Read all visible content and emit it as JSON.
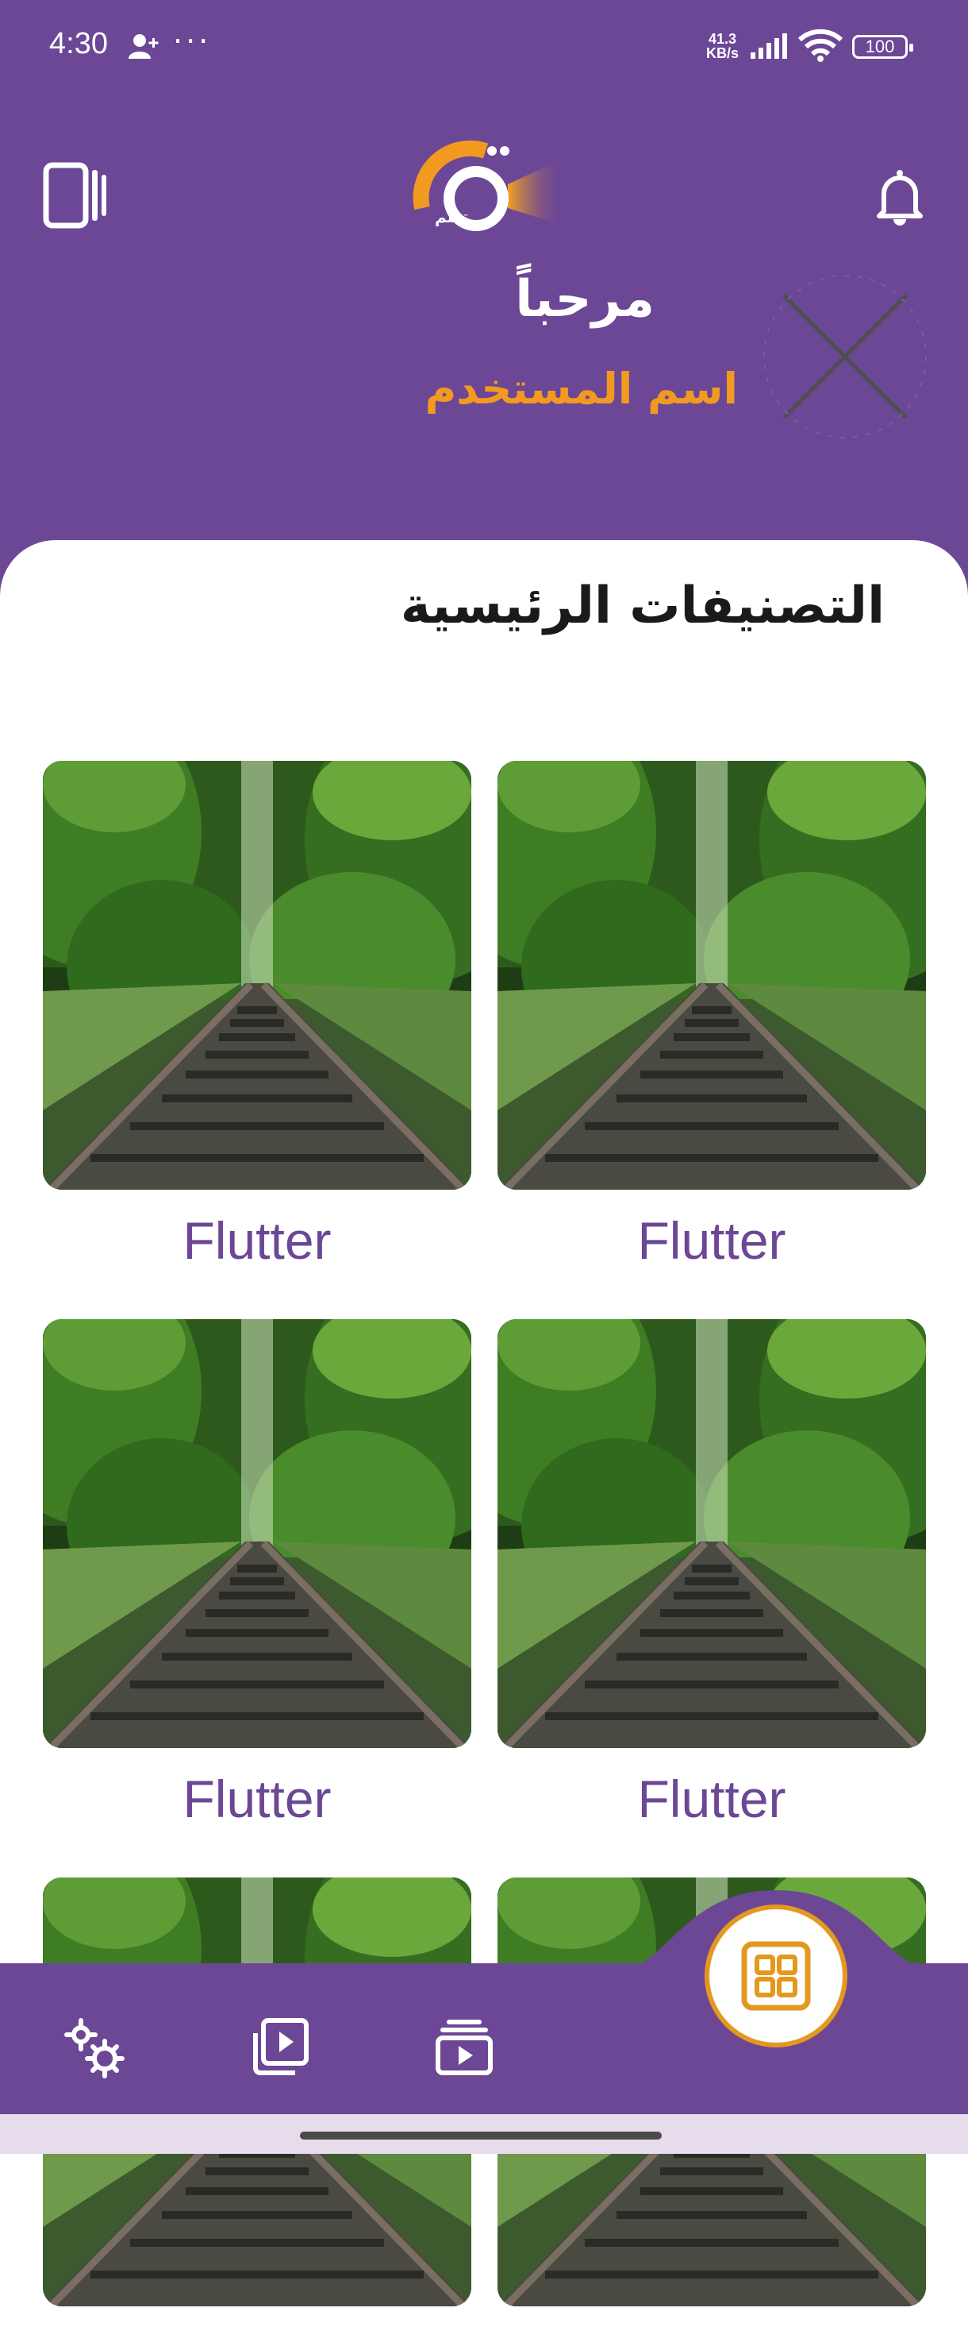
{
  "status_bar": {
    "time": "4:30",
    "dots": "···",
    "net_speed_value": "41.3",
    "net_speed_unit": "KB/s",
    "battery": "100"
  },
  "header": {
    "logo_text": "تعلم",
    "welcome": "مرحباً",
    "username": "اسم المستخدم"
  },
  "section": {
    "title": "التصنيفات الرئيسية"
  },
  "categories": [
    {
      "label": "Flutter"
    },
    {
      "label": "Flutter"
    },
    {
      "label": "Flutter"
    },
    {
      "label": "Flutter"
    },
    {
      "label": ""
    },
    {
      "label": ""
    }
  ],
  "colors": {
    "primary": "#6c4796",
    "accent": "#f29a1f",
    "fab_border": "#e4981f"
  },
  "bottom_nav": {
    "items": [
      "gear-icon",
      "video-library-icon",
      "playlist-play-icon",
      "grid-icon"
    ]
  }
}
